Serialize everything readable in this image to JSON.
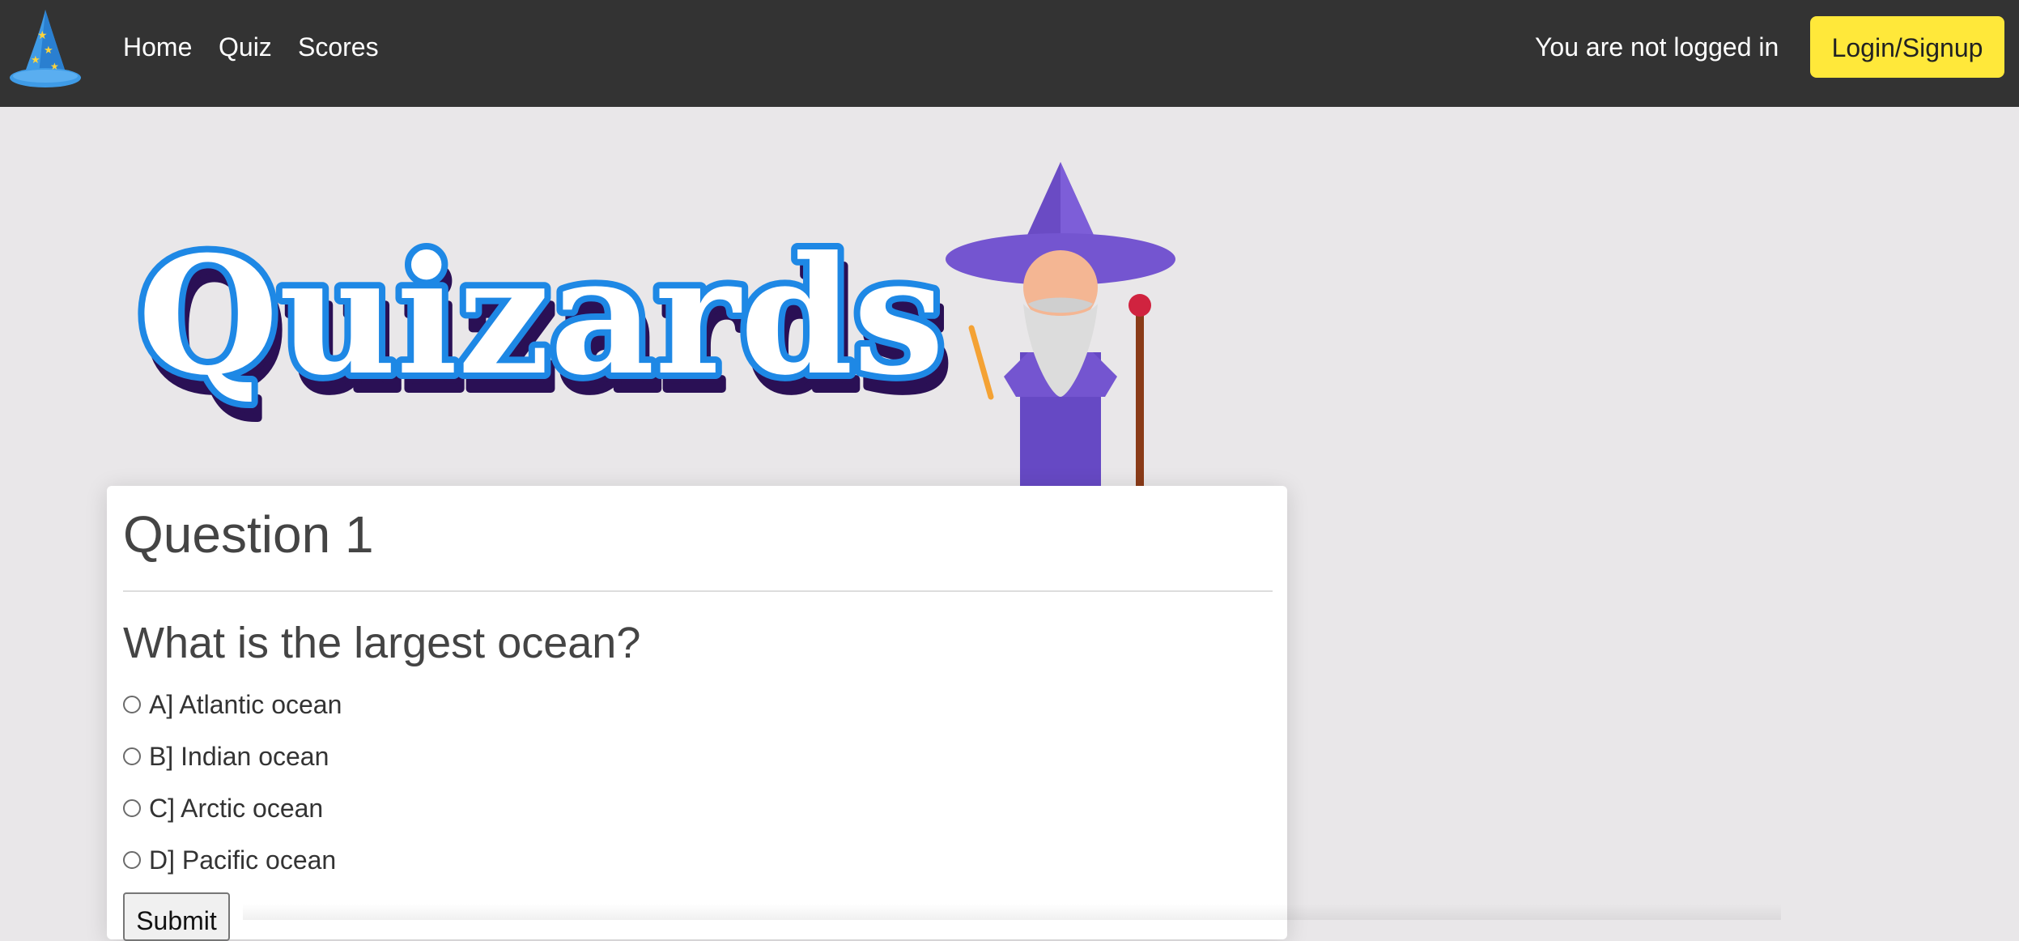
{
  "nav": {
    "links": [
      "Home",
      "Quiz",
      "Scores"
    ],
    "status": "You are not logged in",
    "login_label": "Login/Signup"
  },
  "hero": {
    "brand": "Quizards"
  },
  "question": {
    "number_label": "Question 1",
    "text": "What is the largest ocean?",
    "options": [
      "A] Atlantic ocean",
      "B] Indian ocean",
      "C] Arctic ocean",
      "D] Pacific ocean"
    ],
    "submit_label": "Submit"
  },
  "colors": {
    "navbar": "#333333",
    "page_background": "#e9e7e9",
    "login_button": "#ffe83a",
    "brand_blue": "#1e88e5",
    "brand_purple": "#3d1a6e",
    "wizard_purple": "#7c5fd6"
  }
}
